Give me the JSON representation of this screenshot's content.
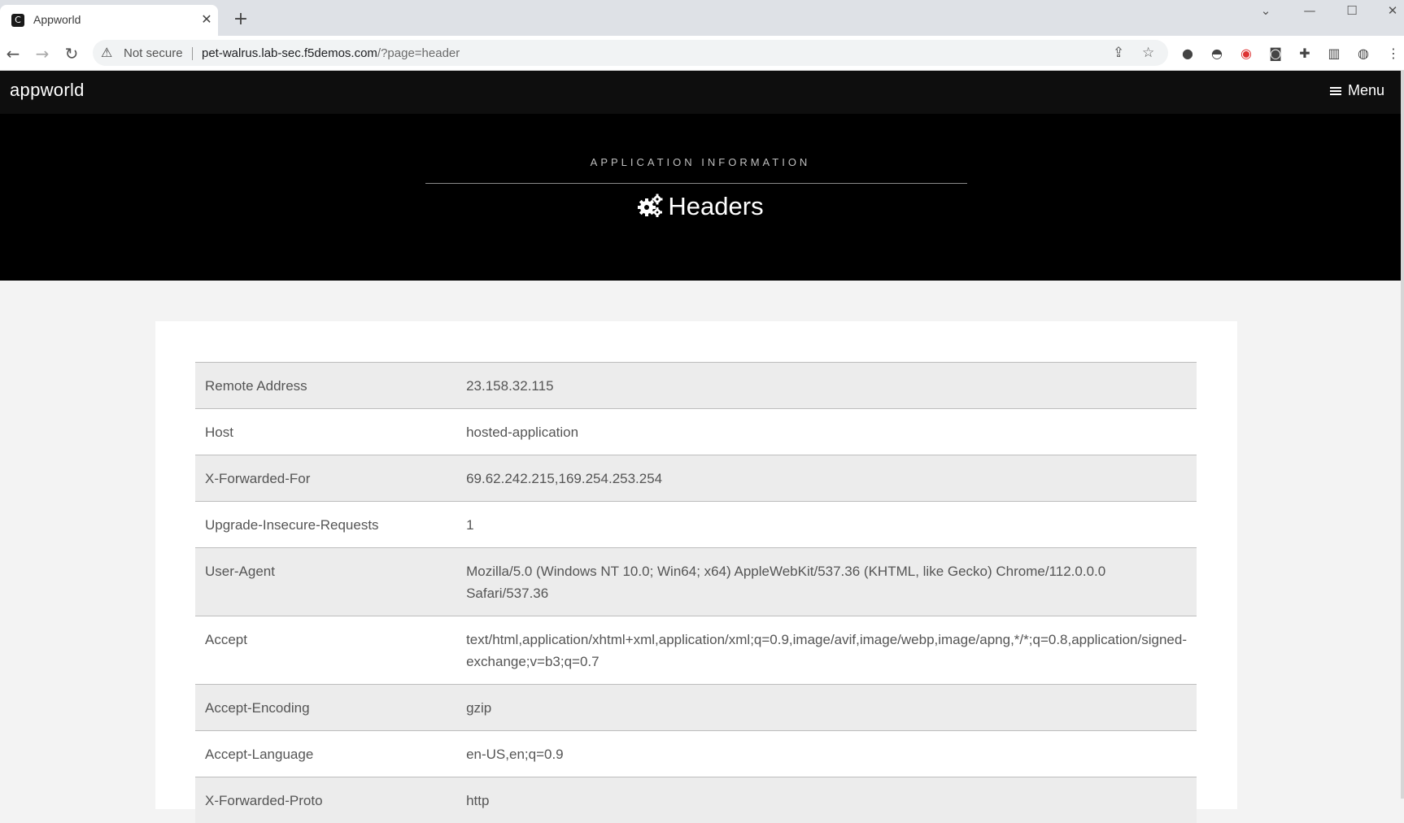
{
  "browser": {
    "tab_title": "Appworld",
    "tab_favicon": "appworld-favicon",
    "security_label": "Not secure",
    "url_host": "pet-walrus.lab-sec.f5demos.com",
    "url_path": "/?page=header"
  },
  "site": {
    "brand": "appworld",
    "menu_label": "Menu",
    "eyebrow": "APPLICATION INFORMATION",
    "page_title": "Headers"
  },
  "headers": [
    {
      "name": "Remote Address",
      "value": "23.158.32.115"
    },
    {
      "name": "Host",
      "value": "hosted-application"
    },
    {
      "name": "X-Forwarded-For",
      "value": "69.62.242.215,169.254.253.254"
    },
    {
      "name": "Upgrade-Insecure-Requests",
      "value": "1"
    },
    {
      "name": "User-Agent",
      "value": "Mozilla/5.0 (Windows NT 10.0; Win64; x64) AppleWebKit/537.36 (KHTML, like Gecko) Chrome/112.0.0.0 Safari/537.36"
    },
    {
      "name": "Accept",
      "value": "text/html,application/xhtml+xml,application/xml;q=0.9,image/avif,image/webp,image/apng,*/*;q=0.8,application/signed-exchange;v=b3;q=0.7"
    },
    {
      "name": "Accept-Encoding",
      "value": "gzip"
    },
    {
      "name": "Accept-Language",
      "value": "en-US,en;q=0.9"
    },
    {
      "name": "X-Forwarded-Proto",
      "value": "http"
    }
  ]
}
